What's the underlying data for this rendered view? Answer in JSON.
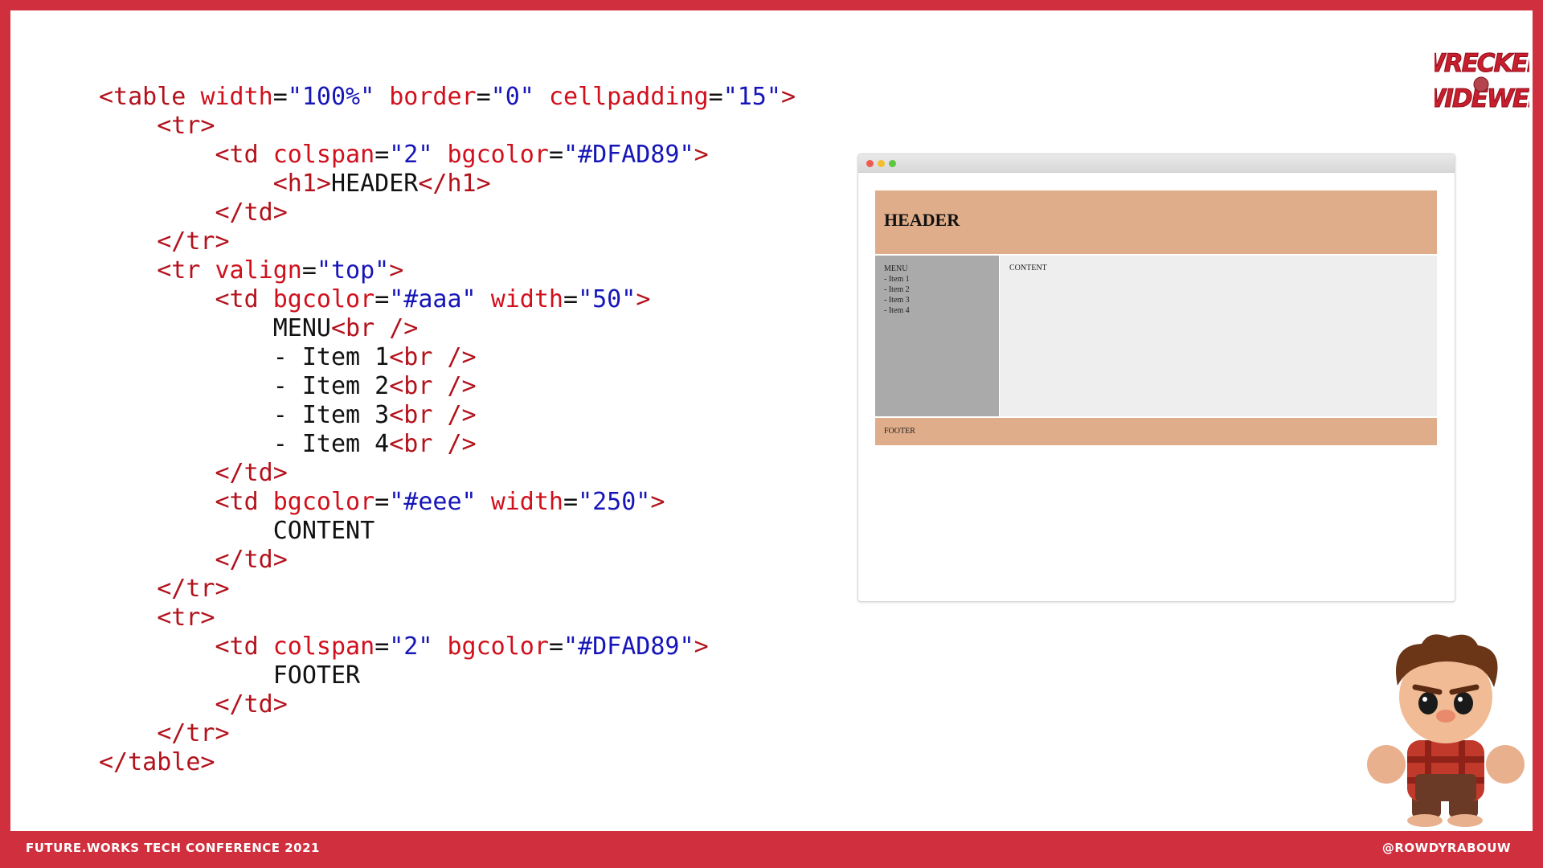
{
  "code": {
    "lines": [
      [
        {
          "c": "tag",
          "t": "<table "
        },
        {
          "c": "attr",
          "t": "width"
        },
        {
          "c": "eq",
          "t": "="
        },
        {
          "c": "str",
          "t": "\"100%\""
        },
        {
          "c": "txt",
          "t": " "
        },
        {
          "c": "attr",
          "t": "border"
        },
        {
          "c": "eq",
          "t": "="
        },
        {
          "c": "str",
          "t": "\"0\""
        },
        {
          "c": "txt",
          "t": " "
        },
        {
          "c": "attr",
          "t": "cellpadding"
        },
        {
          "c": "eq",
          "t": "="
        },
        {
          "c": "str",
          "t": "\"15\""
        },
        {
          "c": "tag",
          "t": ">"
        }
      ],
      [
        {
          "c": "txt",
          "t": "    "
        },
        {
          "c": "tag",
          "t": "<tr>"
        }
      ],
      [
        {
          "c": "txt",
          "t": "        "
        },
        {
          "c": "tag",
          "t": "<td "
        },
        {
          "c": "attr",
          "t": "colspan"
        },
        {
          "c": "eq",
          "t": "="
        },
        {
          "c": "str",
          "t": "\"2\""
        },
        {
          "c": "txt",
          "t": " "
        },
        {
          "c": "attr",
          "t": "bgcolor"
        },
        {
          "c": "eq",
          "t": "="
        },
        {
          "c": "str",
          "t": "\"#DFAD89\""
        },
        {
          "c": "tag",
          "t": ">"
        }
      ],
      [
        {
          "c": "txt",
          "t": "            "
        },
        {
          "c": "tag",
          "t": "<h1>"
        },
        {
          "c": "txt",
          "t": "HEADER"
        },
        {
          "c": "tag",
          "t": "</h1>"
        }
      ],
      [
        {
          "c": "txt",
          "t": "        "
        },
        {
          "c": "tag",
          "t": "</td>"
        }
      ],
      [
        {
          "c": "txt",
          "t": "    "
        },
        {
          "c": "tag",
          "t": "</tr>"
        }
      ],
      [
        {
          "c": "txt",
          "t": "    "
        },
        {
          "c": "tag",
          "t": "<tr "
        },
        {
          "c": "attr",
          "t": "valign"
        },
        {
          "c": "eq",
          "t": "="
        },
        {
          "c": "str",
          "t": "\"top\""
        },
        {
          "c": "tag",
          "t": ">"
        }
      ],
      [
        {
          "c": "txt",
          "t": "        "
        },
        {
          "c": "tag",
          "t": "<td "
        },
        {
          "c": "attr",
          "t": "bgcolor"
        },
        {
          "c": "eq",
          "t": "="
        },
        {
          "c": "str",
          "t": "\"#aaa\""
        },
        {
          "c": "txt",
          "t": " "
        },
        {
          "c": "attr",
          "t": "width"
        },
        {
          "c": "eq",
          "t": "="
        },
        {
          "c": "str",
          "t": "\"50\""
        },
        {
          "c": "tag",
          "t": ">"
        }
      ],
      [
        {
          "c": "txt",
          "t": "            MENU"
        },
        {
          "c": "tag",
          "t": "<br />"
        }
      ],
      [
        {
          "c": "txt",
          "t": "            - Item 1"
        },
        {
          "c": "tag",
          "t": "<br />"
        }
      ],
      [
        {
          "c": "txt",
          "t": "            - Item 2"
        },
        {
          "c": "tag",
          "t": "<br />"
        }
      ],
      [
        {
          "c": "txt",
          "t": "            - Item 3"
        },
        {
          "c": "tag",
          "t": "<br />"
        }
      ],
      [
        {
          "c": "txt",
          "t": "            - Item 4"
        },
        {
          "c": "tag",
          "t": "<br />"
        }
      ],
      [
        {
          "c": "txt",
          "t": "        "
        },
        {
          "c": "tag",
          "t": "</td>"
        }
      ],
      [
        {
          "c": "txt",
          "t": "        "
        },
        {
          "c": "tag",
          "t": "<td "
        },
        {
          "c": "attr",
          "t": "bgcolor"
        },
        {
          "c": "eq",
          "t": "="
        },
        {
          "c": "str",
          "t": "\"#eee\""
        },
        {
          "c": "txt",
          "t": " "
        },
        {
          "c": "attr",
          "t": "width"
        },
        {
          "c": "eq",
          "t": "="
        },
        {
          "c": "str",
          "t": "\"250\""
        },
        {
          "c": "tag",
          "t": ">"
        }
      ],
      [
        {
          "c": "txt",
          "t": "            CONTENT"
        }
      ],
      [
        {
          "c": "txt",
          "t": "        "
        },
        {
          "c": "tag",
          "t": "</td>"
        }
      ],
      [
        {
          "c": "txt",
          "t": "    "
        },
        {
          "c": "tag",
          "t": "</tr>"
        }
      ],
      [
        {
          "c": "txt",
          "t": "    "
        },
        {
          "c": "tag",
          "t": "<tr>"
        }
      ],
      [
        {
          "c": "txt",
          "t": "        "
        },
        {
          "c": "tag",
          "t": "<td "
        },
        {
          "c": "attr",
          "t": "colspan"
        },
        {
          "c": "eq",
          "t": "="
        },
        {
          "c": "str",
          "t": "\"2\""
        },
        {
          "c": "txt",
          "t": " "
        },
        {
          "c": "attr",
          "t": "bgcolor"
        },
        {
          "c": "eq",
          "t": "="
        },
        {
          "c": "str",
          "t": "\"#DFAD89\""
        },
        {
          "c": "tag",
          "t": ">"
        }
      ],
      [
        {
          "c": "txt",
          "t": "            FOOTER"
        }
      ],
      [
        {
          "c": "txt",
          "t": "        "
        },
        {
          "c": "tag",
          "t": "</td>"
        }
      ],
      [
        {
          "c": "txt",
          "t": "    "
        },
        {
          "c": "tag",
          "t": "</tr>"
        }
      ],
      [
        {
          "c": "tag",
          "t": "</table>"
        }
      ]
    ]
  },
  "preview": {
    "header": "HEADER",
    "menu_lines": [
      "MENU",
      "- Item 1",
      "- Item 2",
      "- Item 3",
      "- Item 4"
    ],
    "content": "CONTENT",
    "footer": "FOOTER"
  },
  "logo": {
    "line1": "WRECKED",
    "line2": "WIDE WEB"
  },
  "footer": {
    "left": "FUTURE.WORKS TECH CONFERENCE 2021",
    "right": "@ROWDYRABOUW"
  },
  "colors": {
    "brand_red": "#d02f3e",
    "header_bg": "#DFAD89",
    "menu_bg": "#aaaaaa",
    "content_bg": "#eeeeee"
  }
}
